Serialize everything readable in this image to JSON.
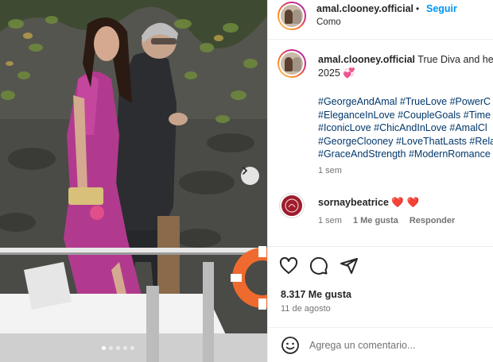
{
  "header": {
    "username": "amal.clooney.official",
    "separator": "•",
    "follow_label": "Seguir",
    "location": "Como"
  },
  "caption": {
    "username": "amal.clooney.official",
    "text_line1": "True Diva and he",
    "text_line2": "2025 💞",
    "hashtag_lines": [
      "#GeorgeAndAmal #TrueLove #PowerC",
      "#EleganceInLove #CoupleGoals #Time",
      "#IconicLove #ChicAndInLove #AmalCl",
      "#GeorgeClooney #LoveThatLasts #Rela",
      "#GraceAndStrength #ModernRomance"
    ],
    "time": "1 sem"
  },
  "comment": {
    "username": "sornaybeatrice",
    "text": "❤️ ❤️",
    "time": "1 sem",
    "likes": "1 Me gusta",
    "reply_label": "Responder"
  },
  "actions": {
    "icons": [
      "heart-icon",
      "comment-icon",
      "share-icon"
    ],
    "likes_text": "8.317 Me gusta",
    "date": "11 de agosto"
  },
  "comment_box": {
    "placeholder": "Agrega un comentario...",
    "emoji_icon": "emoji-icon"
  },
  "carousel": {
    "slide_count": 5,
    "active_index": 0
  },
  "colors": {
    "link_blue": "#0095f6",
    "hashtag_blue": "#00376b",
    "muted_gray": "#737373",
    "dress_magenta": "#b13a8e",
    "lifebuoy_orange": "#ef6a2e"
  }
}
